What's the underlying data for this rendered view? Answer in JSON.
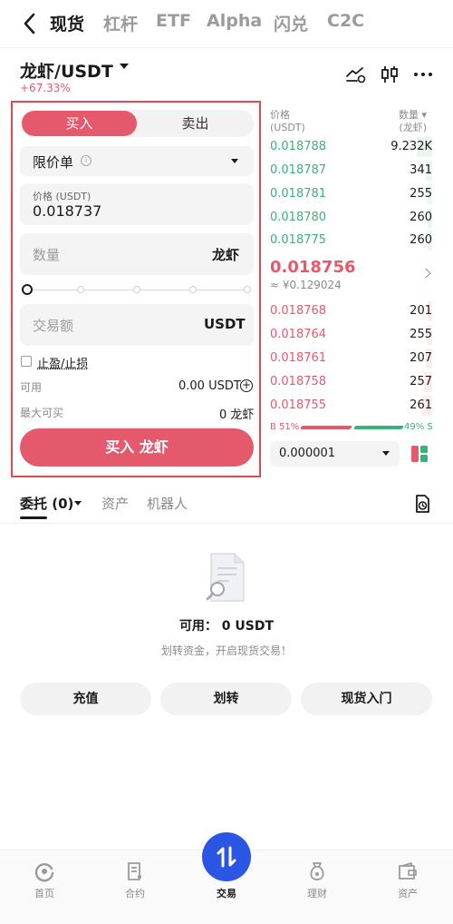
{
  "top_tabs": [
    "现货",
    "杠杆",
    "ETF",
    "Alpha",
    "闪兑",
    "C2C"
  ],
  "pair": {
    "symbol": "龙虾/USDT",
    "change": "+67.33%"
  },
  "order_form": {
    "buy_tab": "买入",
    "sell_tab": "卖出",
    "order_type": "限价单",
    "price_label": "价格 (USDT)",
    "price_value": "0.018737",
    "qty_placeholder": "数量",
    "qty_unit": "龙虾",
    "amount_placeholder": "交易额",
    "amount_unit": "USDT",
    "tpsl_label": "止盈/止损",
    "available_label": "可用",
    "available_value": "0.00 USDT",
    "max_buy_label": "最大可买",
    "max_buy_value": "0 龙虾",
    "submit_label": "买入 龙虾"
  },
  "orderbook": {
    "price_header": "价格",
    "price_unit": "(USDT)",
    "qty_header": "数量",
    "qty_unit": "(龙虾)",
    "asks": [
      {
        "price": "0.018788",
        "qty": "9.232K"
      },
      {
        "price": "0.018787",
        "qty": "341"
      },
      {
        "price": "0.018781",
        "qty": "255"
      },
      {
        "price": "0.018780",
        "qty": "260"
      },
      {
        "price": "0.018775",
        "qty": "260"
      }
    ],
    "last_price": "0.018756",
    "last_price_cny": "≈ ¥0.129024",
    "bids": [
      {
        "price": "0.018768",
        "qty": "201"
      },
      {
        "price": "0.018764",
        "qty": "255"
      },
      {
        "price": "0.018761",
        "qty": "207"
      },
      {
        "price": "0.018758",
        "qty": "257"
      },
      {
        "price": "0.018755",
        "qty": "261"
      }
    ],
    "buy_ratio": "B 51%",
    "sell_ratio": "49% S",
    "precision": "0.000001"
  },
  "orders_tabs": {
    "orders": "委托 (0)",
    "assets": "资产",
    "bots": "机器人"
  },
  "empty_state": {
    "title": "可用： 0 USDT",
    "subtitle": "划转资金，开启现货交易！",
    "deposit": "充值",
    "transfer": "划转",
    "guide": "现货入门"
  },
  "bottom_nav": {
    "home": "首页",
    "contracts": "合约",
    "trade": "交易",
    "finance": "理财",
    "assets": "资产"
  },
  "colors": {
    "buy": "#e5596d",
    "sell": "#3ab07a",
    "accent": "#2a55e5"
  }
}
